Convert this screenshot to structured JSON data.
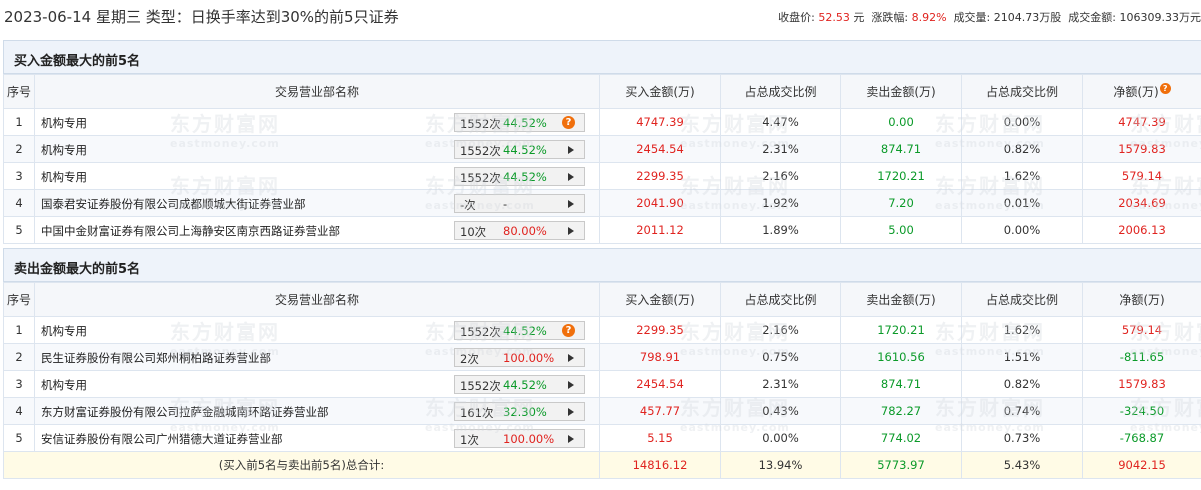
{
  "header": {
    "title": "2023-06-14 星期三 类型：日换手率达到30%的前5只证券",
    "close_label": "收盘价:",
    "close_value": "52.53",
    "close_unit": "元",
    "change_label": "涨跌幅:",
    "change_value": "8.92%",
    "volume_label": "成交量:",
    "volume_value": "2104.73万股",
    "amount_label": "成交金额:",
    "amount_value": "106309.33万元"
  },
  "columns": [
    "序号",
    "交易营业部名称",
    "买入金额(万)",
    "占总成交比例",
    "卖出金额(万)",
    "占总成交比例",
    "净额(万)"
  ],
  "buy_section": {
    "title": "买入金额最大的前5名",
    "rows": [
      {
        "idx": "1",
        "name": "机构专用",
        "count": "1552次",
        "rate": "44.52%",
        "rate_color": "green",
        "icon": "question",
        "buy": "4747.39",
        "buy_pct": "4.47%",
        "sell": "0.00",
        "sell_pct": "0.00%",
        "net": "4747.39",
        "net_color": "red"
      },
      {
        "idx": "2",
        "name": "机构专用",
        "count": "1552次",
        "rate": "44.52%",
        "rate_color": "green",
        "icon": "arrow",
        "buy": "2454.54",
        "buy_pct": "2.31%",
        "sell": "874.71",
        "sell_pct": "0.82%",
        "net": "1579.83",
        "net_color": "red"
      },
      {
        "idx": "3",
        "name": "机构专用",
        "count": "1552次",
        "rate": "44.52%",
        "rate_color": "green",
        "icon": "arrow",
        "buy": "2299.35",
        "buy_pct": "2.16%",
        "sell": "1720.21",
        "sell_pct": "1.62%",
        "net": "579.14",
        "net_color": "red"
      },
      {
        "idx": "4",
        "name": "国泰君安证券股份有限公司成都顺城大街证券营业部",
        "count": "-次",
        "rate": "-",
        "rate_color": "gray",
        "icon": "arrow",
        "buy": "2041.90",
        "buy_pct": "1.92%",
        "sell": "7.20",
        "sell_pct": "0.01%",
        "net": "2034.69",
        "net_color": "red"
      },
      {
        "idx": "5",
        "name": "中国中金财富证券有限公司上海静安区南京西路证券营业部",
        "count": "10次",
        "rate": "80.00%",
        "rate_color": "red",
        "icon": "arrow",
        "buy": "2011.12",
        "buy_pct": "1.89%",
        "sell": "5.00",
        "sell_pct": "0.00%",
        "net": "2006.13",
        "net_color": "red"
      }
    ]
  },
  "sell_section": {
    "title": "卖出金额最大的前5名",
    "rows": [
      {
        "idx": "1",
        "name": "机构专用",
        "count": "1552次",
        "rate": "44.52%",
        "rate_color": "green",
        "icon": "question",
        "buy": "2299.35",
        "buy_pct": "2.16%",
        "sell": "1720.21",
        "sell_pct": "1.62%",
        "net": "579.14",
        "net_color": "red"
      },
      {
        "idx": "2",
        "name": "民生证券股份有限公司郑州桐柏路证券营业部",
        "count": "2次",
        "rate": "100.00%",
        "rate_color": "red",
        "icon": "arrow",
        "buy": "798.91",
        "buy_pct": "0.75%",
        "sell": "1610.56",
        "sell_pct": "1.51%",
        "net": "-811.65",
        "net_color": "green"
      },
      {
        "idx": "3",
        "name": "机构专用",
        "count": "1552次",
        "rate": "44.52%",
        "rate_color": "green",
        "icon": "arrow",
        "buy": "2454.54",
        "buy_pct": "2.31%",
        "sell": "874.71",
        "sell_pct": "0.82%",
        "net": "1579.83",
        "net_color": "red"
      },
      {
        "idx": "4",
        "name": "东方财富证券股份有限公司拉萨金融城南环路证券营业部",
        "count": "161次",
        "rate": "32.30%",
        "rate_color": "green",
        "icon": "arrow",
        "buy": "457.77",
        "buy_pct": "0.43%",
        "sell": "782.27",
        "sell_pct": "0.74%",
        "net": "-324.50",
        "net_color": "green"
      },
      {
        "idx": "5",
        "name": "安信证券股份有限公司广州猎德大道证券营业部",
        "count": "1次",
        "rate": "100.00%",
        "rate_color": "red",
        "icon": "arrow",
        "buy": "5.15",
        "buy_pct": "0.00%",
        "sell": "774.02",
        "sell_pct": "0.73%",
        "net": "-768.87",
        "net_color": "green"
      }
    ]
  },
  "total": {
    "label_prefix": "(买入前5名与卖出前5名)",
    "label_bold": "总合计:",
    "buy": "14816.12",
    "buy_pct": "13.94%",
    "sell": "5773.97",
    "sell_pct": "5.43%",
    "net": "9042.15"
  },
  "watermark": {
    "cn": "东方财富网",
    "en": "eastmoney.com"
  },
  "colors": {
    "up": "#e0231f",
    "down": "#0b9a29",
    "header_bg": "#eef3fa",
    "total_bg": "#fffbe6",
    "help_icon": "#f06f0c"
  }
}
